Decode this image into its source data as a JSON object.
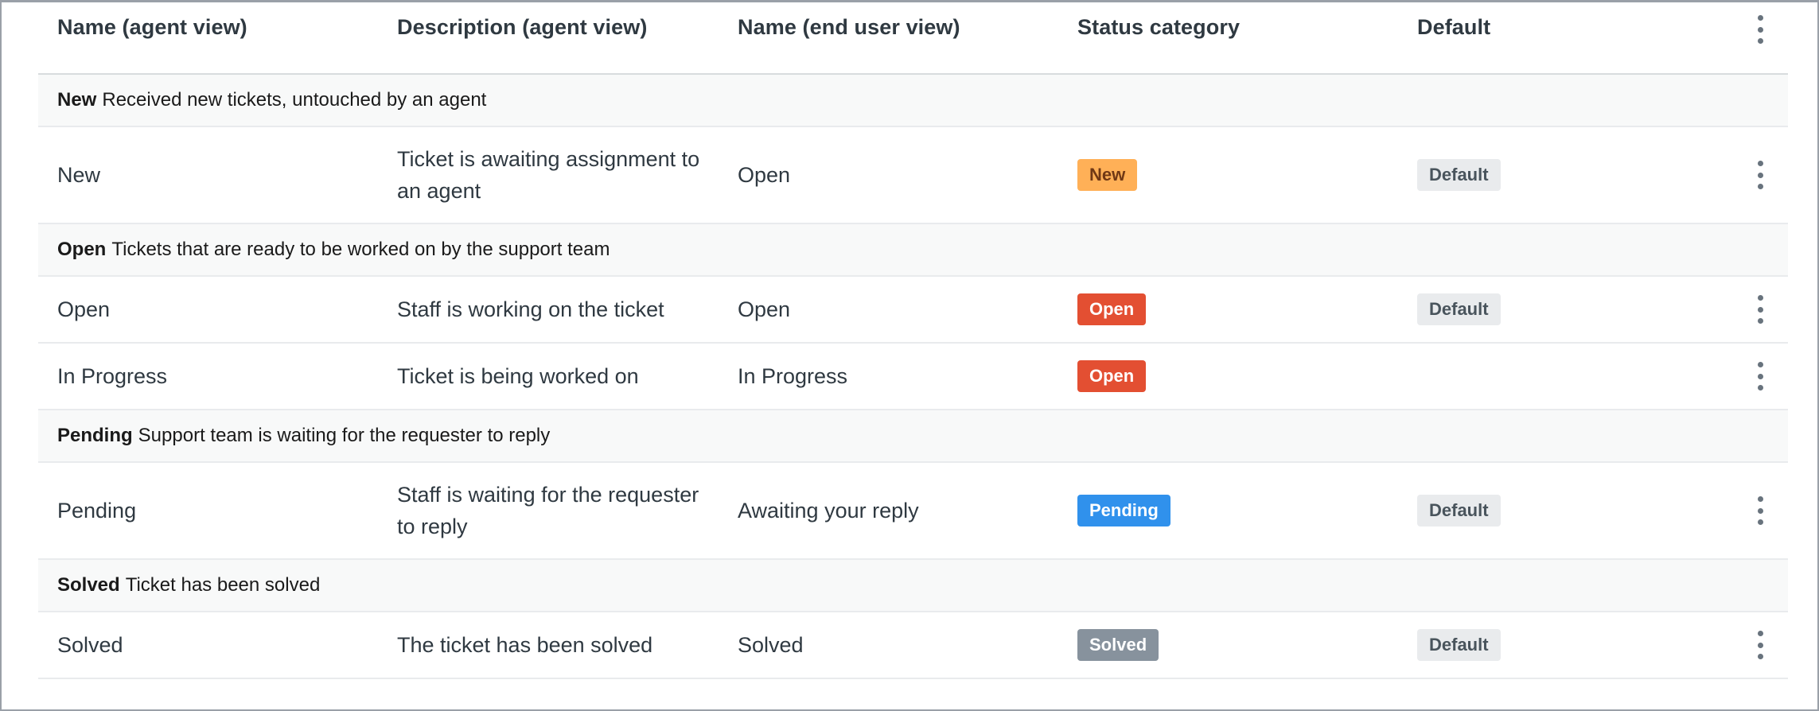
{
  "table": {
    "columns": [
      "Name (agent view)",
      "Description (agent view)",
      "Name (end user view)",
      "Status category",
      "Default"
    ],
    "header_menu_icon": "kebab-vertical-icon",
    "groups": [
      {
        "title": "New",
        "description": "Received new tickets, untouched by an agent",
        "rows": [
          {
            "name": "New",
            "description": "Ticket is awaiting assignment to an agent",
            "end_user_name": "Open",
            "category": {
              "label": "New",
              "bg": "#ffb057",
              "fg": "#703815"
            },
            "default": "Default"
          }
        ]
      },
      {
        "title": "Open",
        "description": "Tickets that are ready to be worked on by the support team",
        "rows": [
          {
            "name": "Open",
            "description": "Staff is working on the ticket",
            "end_user_name": "Open",
            "category": {
              "label": "Open",
              "bg": "#e34f32",
              "fg": "#ffffff"
            },
            "default": "Default"
          },
          {
            "name": "In Progress",
            "description": "Ticket is being worked on",
            "end_user_name": "In Progress",
            "category": {
              "label": "Open",
              "bg": "#e34f32",
              "fg": "#ffffff"
            },
            "default": ""
          }
        ]
      },
      {
        "title": "Pending",
        "description": "Support team is waiting for the requester to reply",
        "rows": [
          {
            "name": "Pending",
            "description": "Staff is waiting for the requester to reply",
            "end_user_name": "Awaiting your reply",
            "category": {
              "label": "Pending",
              "bg": "#3091ec",
              "fg": "#ffffff"
            },
            "default": "Default"
          }
        ]
      },
      {
        "title": "Solved",
        "description": "Ticket has been solved",
        "rows": [
          {
            "name": "Solved",
            "description": "The ticket has been solved",
            "end_user_name": "Solved",
            "category": {
              "label": "Solved",
              "bg": "#87929d",
              "fg": "#ffffff"
            },
            "default": "Default"
          }
        ]
      }
    ]
  }
}
